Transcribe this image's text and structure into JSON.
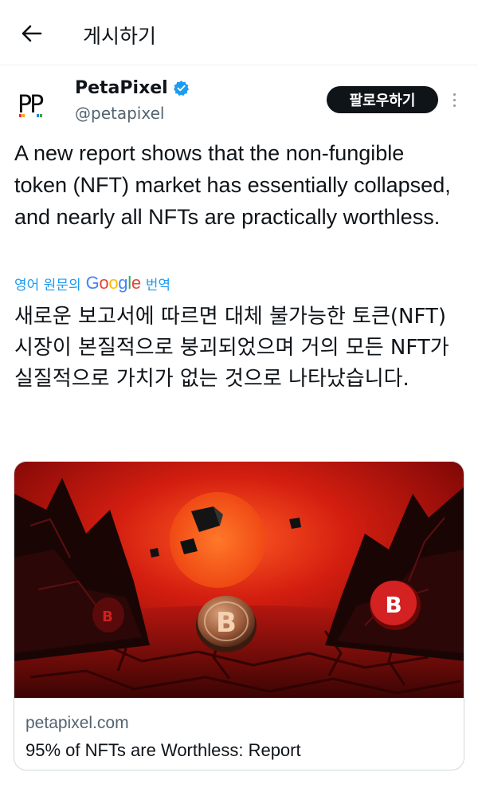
{
  "header": {
    "back_icon": "arrow-left-icon",
    "title": "게시하기"
  },
  "author": {
    "avatar_text": "PP",
    "name": "PetaPixel",
    "verified_icon": "verified-badge-icon",
    "handle": "@petapixel",
    "follow_label": "팔로우하기",
    "more_icon": "more-vertical-icon"
  },
  "tweet": {
    "text": "A new report shows that the non-fungible token (NFT) market has essentially collapsed, and nearly all NFTs are practically worthless.",
    "translate": {
      "prefix": "영어 원문의",
      "brand": "Google",
      "suffix": "번역"
    },
    "translated_text": "새로운 보고서에 따르면 대체 불가능한 토큰(NFT) 시장이 본질적으로 붕괴되었으며 거의 모든 NFT가 실질적으로 가치가 없는 것으로 나타났습니다."
  },
  "card": {
    "image_description_icon": "nft-collapse-illustration",
    "domain": "petapixel.com",
    "title": "95% of NFTs are Worthless: Report"
  },
  "colors": {
    "link_blue": "#1d9bf0",
    "text_primary": "#0f1419",
    "text_secondary": "#536471",
    "button_dark": "#0f1419",
    "verified_blue": "#1d9bf0"
  }
}
